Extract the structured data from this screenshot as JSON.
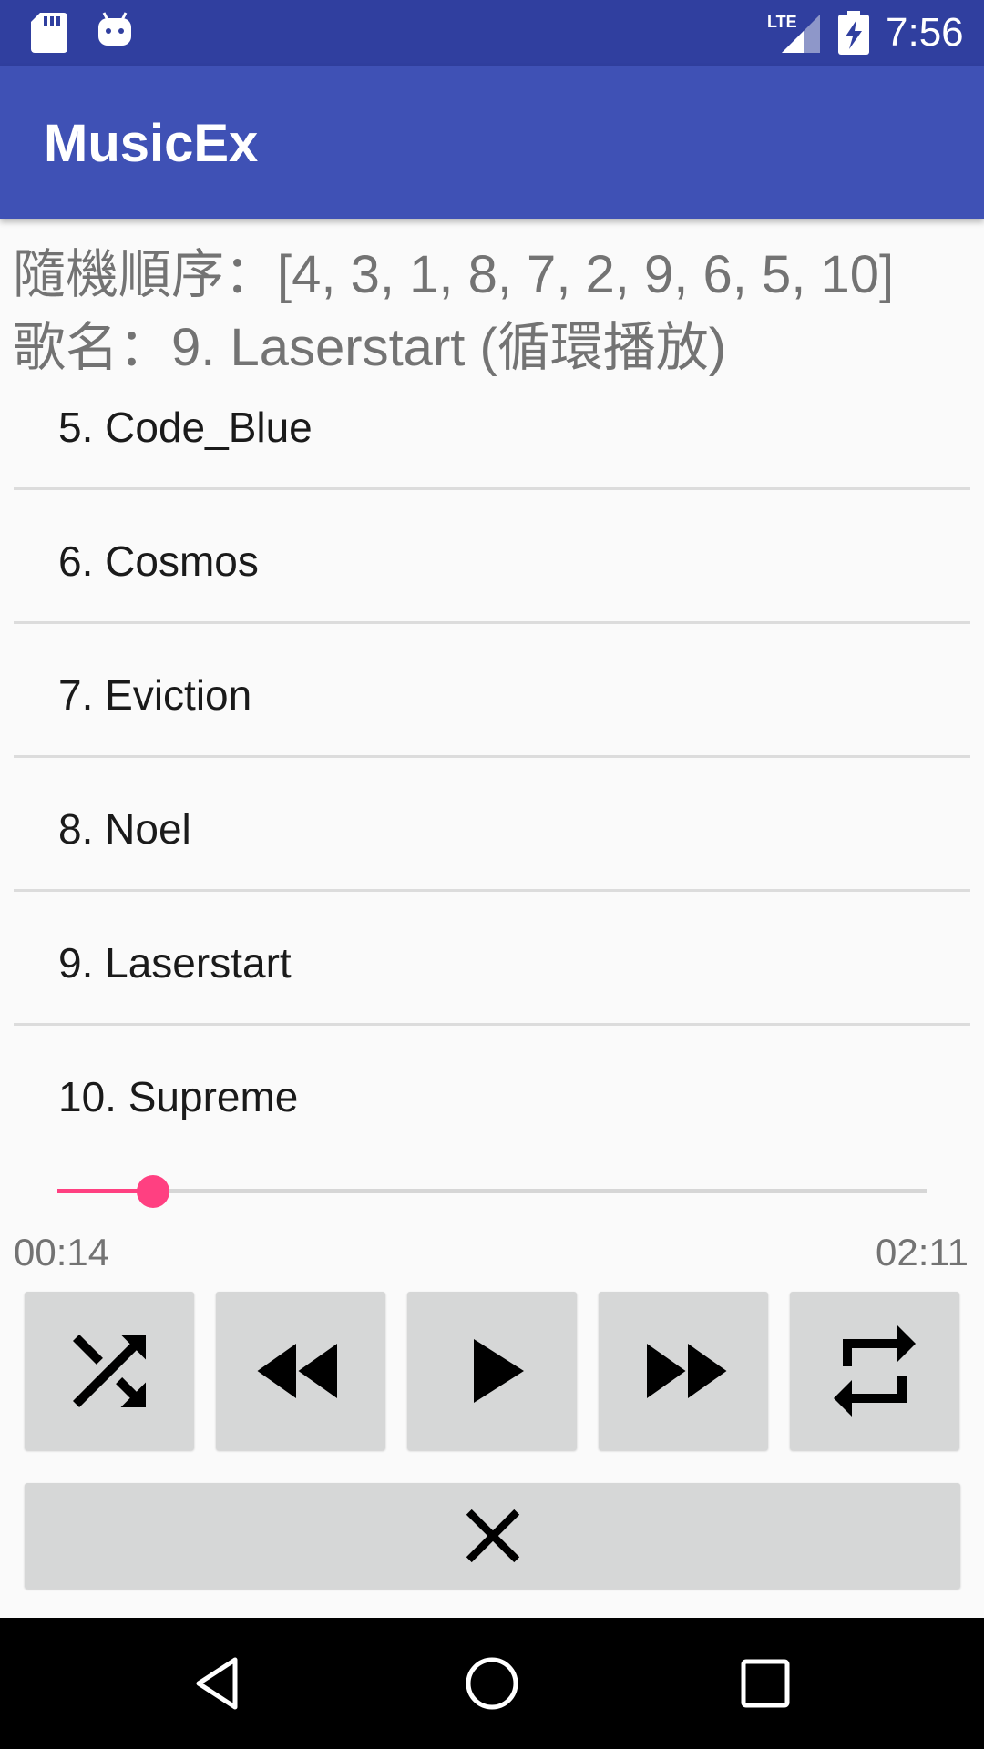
{
  "status_bar": {
    "time": "7:56",
    "icons": [
      "sd-card-icon",
      "android-icon",
      "lte-signal-icon",
      "battery-charging-icon"
    ]
  },
  "app_bar": {
    "title": "MusicEx"
  },
  "info": {
    "shuffle_order": "隨機順序：[4, 3, 1, 8, 7, 2, 9, 6, 5, 10]",
    "song_name": "歌名：9. Laserstart (循環播放)"
  },
  "song_list": [
    "5. Code_Blue",
    "6. Cosmos",
    "7. Eviction",
    "8. Noel",
    "9. Laserstart",
    "10. Supreme"
  ],
  "player": {
    "current_time": "00:14",
    "total_time": "02:11",
    "progress_fraction": 0.11,
    "accent_color": "#ff4081"
  },
  "controls": {
    "buttons": [
      "shuffle-icon",
      "rewind-icon",
      "play-icon",
      "fast-forward-icon",
      "repeat-icon"
    ],
    "close": "close-icon"
  },
  "colors": {
    "status_bar": "#303f9f",
    "app_bar": "#3f51b5",
    "button_bg": "#d6d7d7"
  }
}
